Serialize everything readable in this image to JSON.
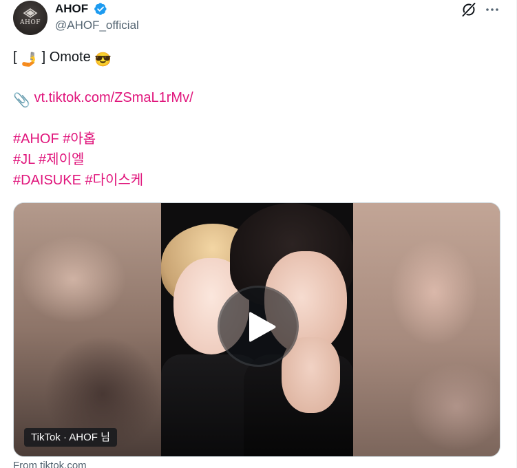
{
  "author": {
    "display_name": "AHOF",
    "handle": "@AHOF_official",
    "avatar_text": "AHOF",
    "verified": true,
    "verified_color": "#1d9bf0"
  },
  "tweet": {
    "line1_open": "[",
    "line1_emoji1": "🤳",
    "line1_close": "] Omote",
    "line1_emoji2": "😎",
    "link_emoji": "📎",
    "link_text": "vt.tiktok.com/ZSmaL1rMv/",
    "hashtags_line1": "#AHOF #아홉",
    "hashtags_line2": "#JL #제이엘",
    "hashtags_line3": "#DAISUKE #다이스케"
  },
  "media": {
    "source_badge": "TikTok · AHOF 님",
    "from_text": "From tiktok.com"
  },
  "colors": {
    "link": "#e0147b",
    "text": "#0f1419",
    "secondary": "#536471"
  },
  "icons": {
    "grok": "grok-icon",
    "more": "more-icon",
    "play": "play-icon"
  }
}
